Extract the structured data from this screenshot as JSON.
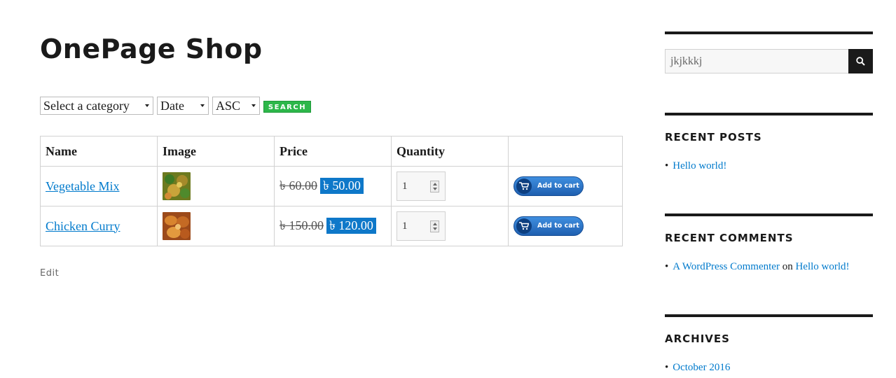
{
  "page": {
    "title": "OnePage Shop",
    "edit_label": "Edit"
  },
  "filters": {
    "category": "Select a category",
    "orderby": "Date",
    "order": "ASC",
    "search_button": "SEARCH"
  },
  "table": {
    "headers": [
      "Name",
      "Image",
      "Price",
      "Quantity",
      ""
    ],
    "rows": [
      {
        "name": "Vegetable Mix",
        "regular_price": "৳ 60.00",
        "sale_price": "৳ 50.00",
        "quantity": "1",
        "add_to_cart": "Add to cart"
      },
      {
        "name": "Chicken Curry",
        "regular_price": "৳ 150.00",
        "sale_price": "৳ 120.00",
        "quantity": "1",
        "add_to_cart": "Add to cart"
      }
    ]
  },
  "sidebar": {
    "search": {
      "value": "jkjkkkj"
    },
    "recent_posts": {
      "title": "RECENT POSTS",
      "items": [
        "Hello world!"
      ]
    },
    "recent_comments": {
      "title": "RECENT COMMENTS",
      "author": "A WordPress Commenter",
      "on": "on",
      "post": "Hello world!"
    },
    "archives": {
      "title": "ARCHIVES",
      "items": [
        "October 2016"
      ]
    }
  },
  "colors": {
    "link": "#007acc",
    "sale_badge": "#0e78c9",
    "search_button": "#2db74a",
    "text": "#1a1a1a"
  },
  "icons": {
    "search": "search-icon",
    "cart": "cart-icon",
    "spinner": "number-spinner-icon"
  }
}
